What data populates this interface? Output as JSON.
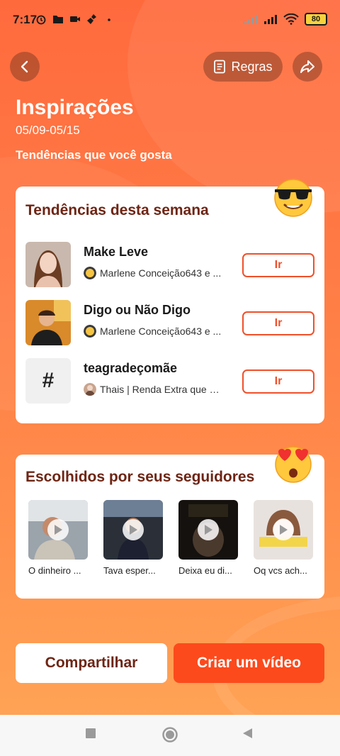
{
  "status_bar": {
    "time": "7:17",
    "battery": "80",
    "icons": [
      "alarm-icon",
      "folder-icon",
      "video-camera-icon",
      "broom-icon",
      "dot-icon",
      "signal-off-icon",
      "signal-icon",
      "wifi-icon",
      "battery-icon"
    ]
  },
  "header": {
    "rules_label": "Regras",
    "title": "Inspirações",
    "dates": "05/09-05/15",
    "subtitle": "Tendências que você gosta"
  },
  "trends": {
    "title": "Tendências desta semana",
    "go_label": "Ir",
    "items": [
      {
        "name": "Make Leve",
        "meta": "Marlene Conceição643 e ..."
      },
      {
        "name": "Digo ou Não Digo",
        "meta": "Marlene Conceição643 e ..."
      },
      {
        "name": "teagradeçomãe",
        "meta": "Thais | Renda Extra que vo..."
      }
    ],
    "hashtag_symbol": "#"
  },
  "followers": {
    "title": "Escolhidos por seus seguidores",
    "videos": [
      {
        "caption": "O dinheiro ..."
      },
      {
        "caption": "Tava esper..."
      },
      {
        "caption": "Deixa eu di..."
      },
      {
        "caption": "Oq vcs ach..."
      }
    ]
  },
  "actions": {
    "share_label": "Compartilhar",
    "create_label": "Criar um vídeo"
  },
  "colors": {
    "accent": "#fc4a1c",
    "title_brown": "#6e2514",
    "button_outline": "#f0502a"
  }
}
